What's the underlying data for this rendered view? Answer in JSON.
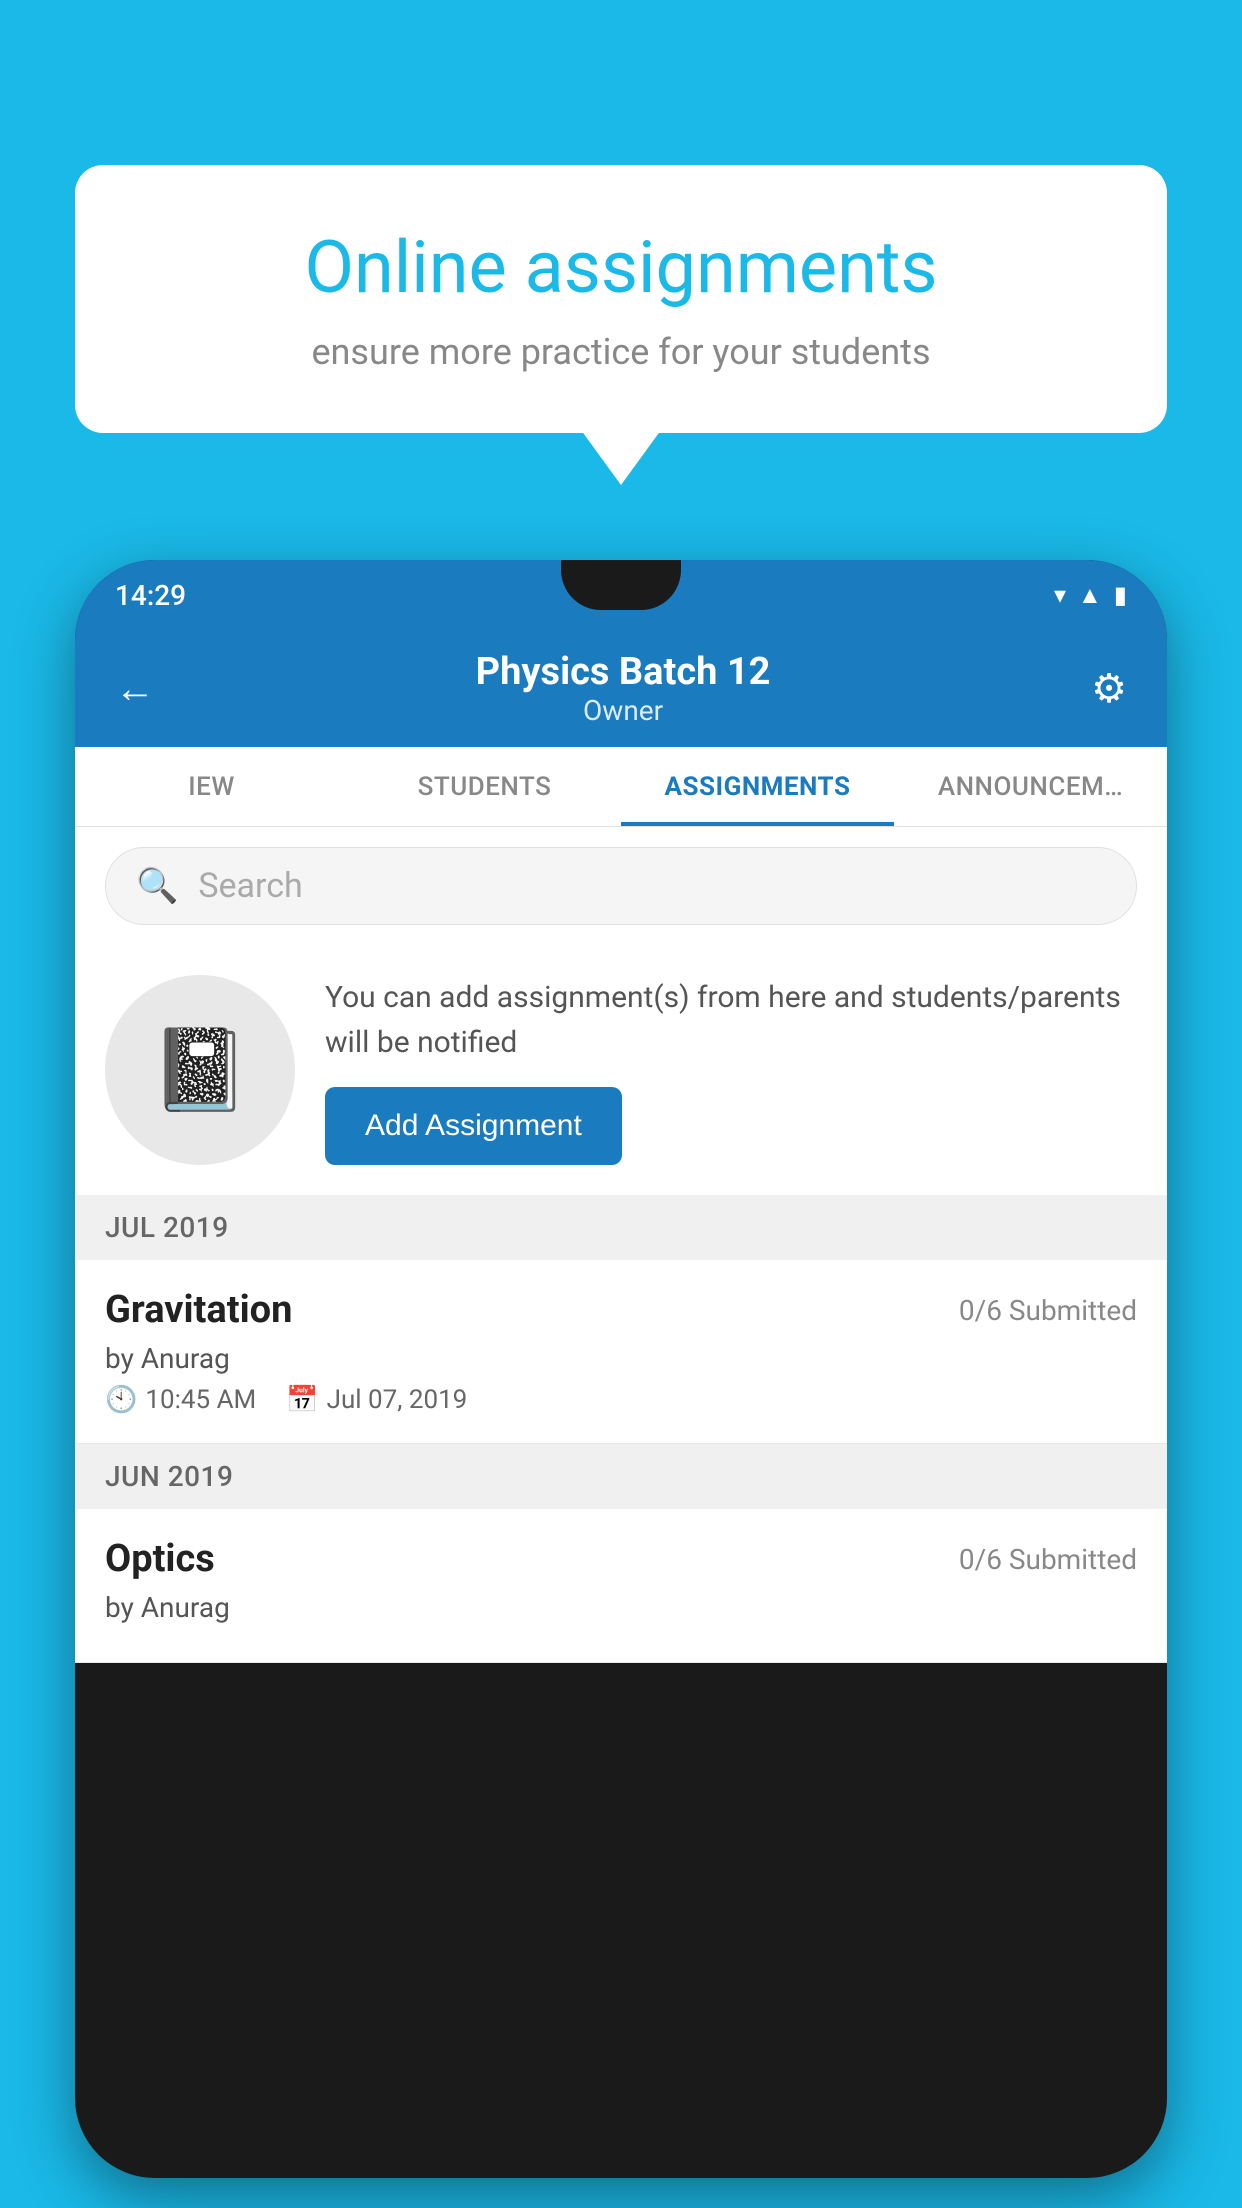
{
  "background_color": "#1ab9e8",
  "speech_bubble": {
    "title": "Online assignments",
    "subtitle": "ensure more practice for your students"
  },
  "phone": {
    "status_bar": {
      "time": "14:29",
      "icons": [
        "wifi",
        "signal",
        "battery"
      ]
    },
    "app_header": {
      "title": "Physics Batch 12",
      "subtitle": "Owner",
      "back_label": "←",
      "settings_label": "⚙"
    },
    "tabs": [
      {
        "label": "IEW",
        "active": false
      },
      {
        "label": "STUDENTS",
        "active": false
      },
      {
        "label": "ASSIGNMENTS",
        "active": true
      },
      {
        "label": "ANNOUNCEMENTS",
        "active": false
      }
    ],
    "search": {
      "placeholder": "Search"
    },
    "promo": {
      "description": "You can add assignment(s) from here and students/parents will be notified",
      "button_label": "Add Assignment"
    },
    "sections": [
      {
        "header": "JUL 2019",
        "assignments": [
          {
            "title": "Gravitation",
            "submitted": "0/6 Submitted",
            "by": "by Anurag",
            "time": "10:45 AM",
            "date": "Jul 07, 2019"
          }
        ]
      },
      {
        "header": "JUN 2019",
        "assignments": [
          {
            "title": "Optics",
            "submitted": "0/6 Submitted",
            "by": "by Anurag",
            "time": "",
            "date": ""
          }
        ]
      }
    ]
  }
}
